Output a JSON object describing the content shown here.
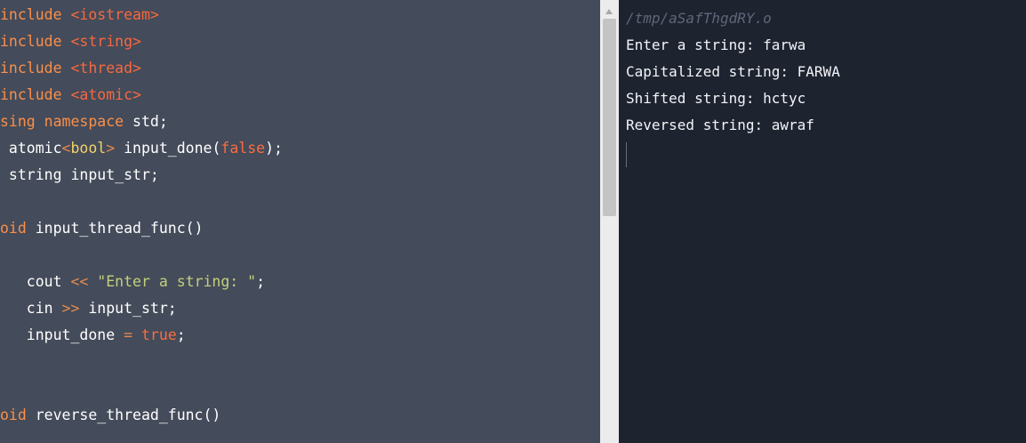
{
  "editor": {
    "lines": [
      [
        {
          "t": "include ",
          "c": "kw"
        },
        {
          "t": "<iostream>",
          "c": "inc"
        }
      ],
      [
        {
          "t": "include ",
          "c": "kw"
        },
        {
          "t": "<string>",
          "c": "inc"
        }
      ],
      [
        {
          "t": "include ",
          "c": "kw"
        },
        {
          "t": "<thread>",
          "c": "inc"
        }
      ],
      [
        {
          "t": "include ",
          "c": "kw"
        },
        {
          "t": "<atomic>",
          "c": "inc"
        }
      ],
      [
        {
          "t": "sing namespace ",
          "c": "kw"
        },
        {
          "t": "std;",
          "c": "id"
        }
      ],
      [
        {
          "t": " atomic",
          "c": "id"
        },
        {
          "t": "<",
          "c": "op"
        },
        {
          "t": "bool",
          "c": "type"
        },
        {
          "t": "> ",
          "c": "op"
        },
        {
          "t": "input_done(",
          "c": "id"
        },
        {
          "t": "false",
          "c": "bool"
        },
        {
          "t": ");",
          "c": "punc"
        }
      ],
      [
        {
          "t": " string input_str;",
          "c": "id"
        }
      ],
      [],
      [
        {
          "t": "oid ",
          "c": "kw"
        },
        {
          "t": "input_thread_func()",
          "c": "id"
        }
      ],
      [],
      [
        {
          "t": "   cout ",
          "c": "id"
        },
        {
          "t": "<<",
          "c": "op"
        },
        {
          "t": " ",
          "c": "id"
        },
        {
          "t": "\"Enter a string: \"",
          "c": "str"
        },
        {
          "t": ";",
          "c": "punc"
        }
      ],
      [
        {
          "t": "   cin ",
          "c": "id"
        },
        {
          "t": ">>",
          "c": "op"
        },
        {
          "t": " input_str;",
          "c": "id"
        }
      ],
      [
        {
          "t": "   input_done ",
          "c": "id"
        },
        {
          "t": "=",
          "c": "op"
        },
        {
          "t": " ",
          "c": "id"
        },
        {
          "t": "true",
          "c": "bool"
        },
        {
          "t": ";",
          "c": "punc"
        }
      ],
      [],
      [],
      [
        {
          "t": "oid ",
          "c": "kw"
        },
        {
          "t": "reverse_thread_func()",
          "c": "id"
        }
      ]
    ]
  },
  "output": {
    "path": "/tmp/aSafThgdRY.o",
    "lines": [
      "Enter a string: farwa",
      "Capitalized string: FARWA",
      "Shifted string: hctyc",
      "Reversed string: awraf"
    ]
  },
  "colors": {
    "editor_bg": "#444b5a",
    "output_bg": "#1e2330",
    "keyword": "#fb8f49",
    "include": "#f8683e",
    "string": "#c3d07a",
    "type": "#f4d26b"
  }
}
